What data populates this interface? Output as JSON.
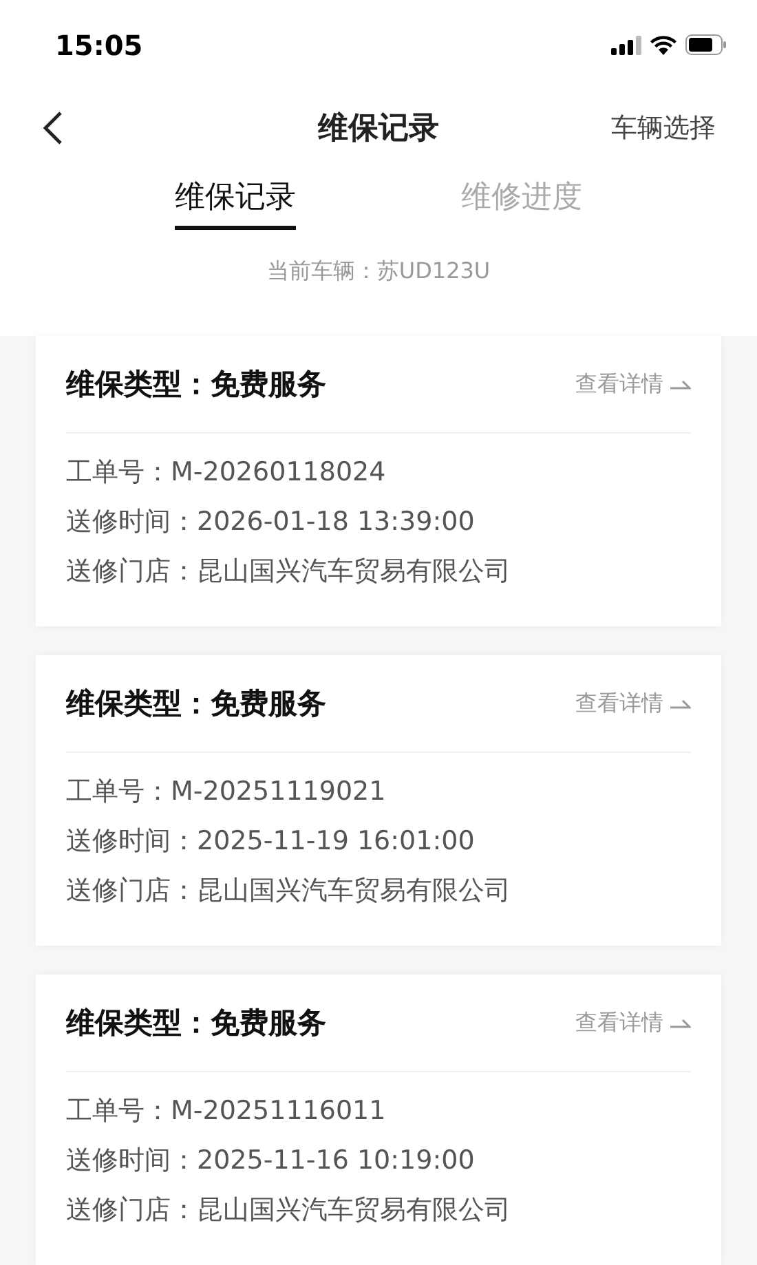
{
  "status_bar": {
    "time": "15:05"
  },
  "nav": {
    "title": "维保记录",
    "action": "车辆选择"
  },
  "tabs": [
    {
      "label": "维保记录",
      "selected": true
    },
    {
      "label": "维修进度",
      "selected": false
    }
  ],
  "current_vehicle": "当前车辆：苏UD123U",
  "records": [
    {
      "type": "维保类型：免费服务",
      "details_link": "查看详情",
      "order_no": "工单号：M-20260118024",
      "time": "送修时间：2026-01-18 13:39:00",
      "store": "送修门店：昆山国兴汽车贸易有限公司"
    },
    {
      "type": "维保类型：免费服务",
      "details_link": "查看详情",
      "order_no": "工单号：M-20251119021",
      "time": "送修时间：2025-11-19 16:01:00",
      "store": "送修门店：昆山国兴汽车贸易有限公司"
    },
    {
      "type": "维保类型：免费服务",
      "details_link": "查看详情",
      "order_no": "工单号：M-20251116011",
      "time": "送修时间：2025-11-16 10:19:00",
      "store": "送修门店：昆山国兴汽车贸易有限公司"
    }
  ]
}
